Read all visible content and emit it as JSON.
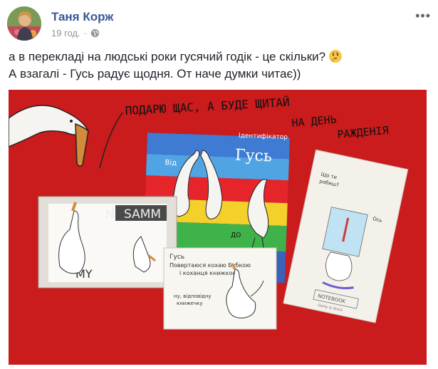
{
  "post": {
    "author": "Таня Корж",
    "time": "19 год.",
    "separator": "·",
    "more_menu": "•••",
    "audience_icon": "globe-icon",
    "text_line1": "а в перекладі на людські роки гусячий годік - це скільки?",
    "text_line2": "А взагалі - Гусь радує щодня. От наче думки читає))",
    "emoji": "thinking-face",
    "colors": {
      "author_link": "#385898",
      "meta": "#90949c",
      "photo_background": "#d21c1e"
    }
  },
  "photo": {
    "handwritten_caption_line1": "ПОДАРЮ ЩАС, А БУДЕ ЩИТАЙ",
    "handwritten_caption_line2": "НА ДЕНЬ",
    "handwritten_caption_line3": "РАЖДЕНІЯ",
    "book_title": "Гусь",
    "book_label": "Ідентифікатор",
    "book_side_label": "Від",
    "book_do": "ДО",
    "shirt_text_1": "SAMM",
    "shirt_text_2": "N",
    "shirt_text_3": "MY",
    "card_title": "Гусь",
    "card_line1": "Повертаюся кохаю Бубкою",
    "card_line2": "і коханця книжкою",
    "card_line3": "ну, відповідну",
    "card_line4": "книжечку",
    "notebook_label": "NOTEBOOK",
    "notebook_brand": "Gorky & Stock",
    "notebook_note1": "Що ти",
    "notebook_note2": "робиш?",
    "notebook_note3": "Ось"
  }
}
